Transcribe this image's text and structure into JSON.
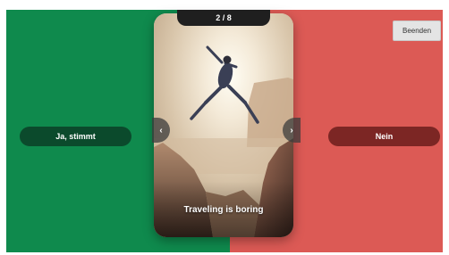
{
  "buttons": {
    "quit_label": "Beenden",
    "yes_label": "Ja, stimmt",
    "no_label": "Nein"
  },
  "card": {
    "counter": "2 / 8",
    "statement": "Traveling is boring",
    "prev_icon": "chevron-left-icon",
    "next_icon": "chevron-right-icon",
    "prev_glyph": "‹",
    "next_glyph": "›"
  },
  "colors": {
    "agree": "#0f8a4d",
    "disagree": "#dc5a55",
    "agree_button": "#0b4a2c",
    "disagree_button": "#7c2624"
  }
}
